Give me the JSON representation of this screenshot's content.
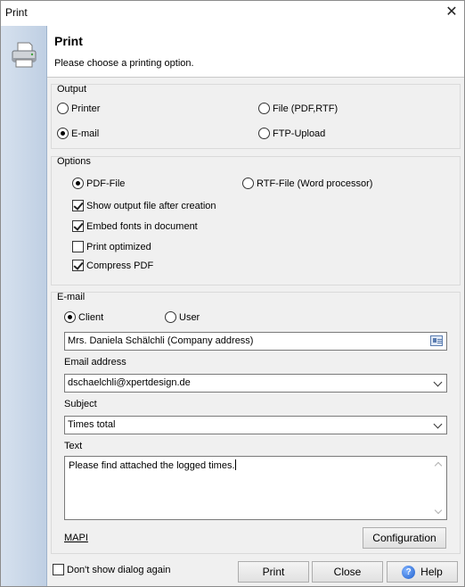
{
  "window": {
    "title": "Print",
    "close_glyph": "✕"
  },
  "header": {
    "title": "Print",
    "subtitle": "Please choose a printing option."
  },
  "output": {
    "label": "Output",
    "options": [
      {
        "label": "Printer",
        "selected": false
      },
      {
        "label": "File (PDF,RTF)",
        "selected": false
      },
      {
        "label": "E-mail",
        "selected": true
      },
      {
        "label": "FTP-Upload",
        "selected": false
      }
    ]
  },
  "options": {
    "label": "Options",
    "format": [
      {
        "label": "PDF-File",
        "selected": true
      },
      {
        "label": "RTF-File (Word processor)",
        "selected": false
      }
    ],
    "checks": [
      {
        "label": "Show output file after creation",
        "checked": true
      },
      {
        "label": "Embed fonts in document",
        "checked": true
      },
      {
        "label": "Print optimized",
        "checked": false
      },
      {
        "label": "Compress PDF",
        "checked": true
      }
    ]
  },
  "email": {
    "label": "E-mail",
    "mode": [
      {
        "label": "Client",
        "selected": true
      },
      {
        "label": "User",
        "selected": false
      }
    ],
    "recipient": "Mrs. Daniela Schälchli (Company address)",
    "address_label": "Email address",
    "address_value": "dschaelchli@xpertdesign.de",
    "subject_label": "Subject",
    "subject_value": "Times total",
    "text_label": "Text",
    "text_value": "Please find attached the logged times.",
    "mapi_label": "MAPI",
    "configuration_label": "Configuration"
  },
  "footer": {
    "dont_show_label": "Don't show dialog again",
    "print_label": "Print",
    "close_label": "Close",
    "help_label": "Help",
    "help_glyph": "?"
  }
}
